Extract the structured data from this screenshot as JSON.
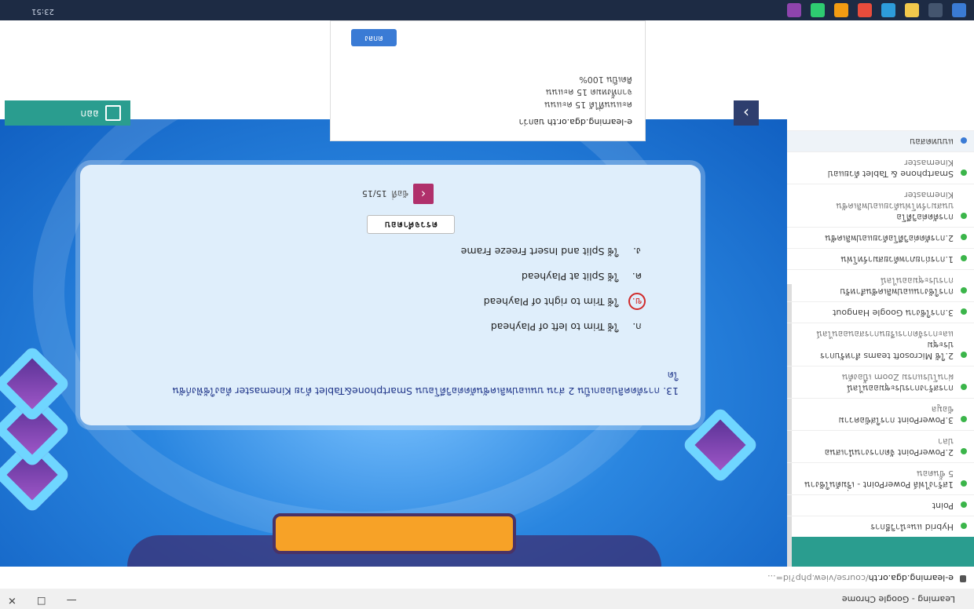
{
  "browser": {
    "window_title": "Learning - Google Chrome",
    "url_host": "e-learning.dga.or.th",
    "url_path": "/course/view.php?id=..."
  },
  "sidebar": {
    "items": [
      {
        "label": "Hybrid แนะนำวิธีการ",
        "sub": "",
        "active": false
      },
      {
        "label": "Point",
        "sub": "",
        "active": false
      },
      {
        "label": "1สร้างไฟล์ PowerPoint - เริ่มต้นใช้งาน",
        "sub": "5 ขั้นตอน",
        "active": false
      },
      {
        "label": "2.PowerPoint จัดการงานนำเสนอ",
        "sub": "ปลา",
        "active": false
      },
      {
        "label": "3.PowerPoint การใส่ข้อความ",
        "sub": "ข้อมูล",
        "active": false
      },
      {
        "label": "การสร้างการประชุมออนไลน์",
        "sub": "ผ่านโปรแกรม Zoom เบื้องต้น",
        "active": false
      },
      {
        "label": "2.ใช้ Microsoft teams สำหรับการประชุม",
        "sub": "และการจัดการเรียนการสอนออนไลน์",
        "active": false
      },
      {
        "label": "3.การใช้งาน Google Hangout",
        "sub": "",
        "active": false
      },
      {
        "label": "การใช้งานแอปพลิเคชันสำหรับ",
        "sub": "การประชุมออนไลน์",
        "active": false
      },
      {
        "label": "1.การถ่ายภาพด้วยสมาร์ทโฟน",
        "sub": "",
        "active": false
      },
      {
        "label": "2.การตัดต่อวิดีโอด้วยแอปพลิเคชัน",
        "sub": "",
        "active": false
      },
      {
        "label": "การตัดต่อวิดีโอ",
        "sub": "บนสมาร์ทโฟนด้วยแอปพลิเคชัน Kinemaster",
        "active": false
      },
      {
        "label": "Smartphone & Tablet ด้วยแอป",
        "sub": "Kinemaster",
        "active": false
      },
      {
        "label": "แบบทดสอบ",
        "sub": "",
        "active": true
      }
    ]
  },
  "quiz": {
    "question": "13. การตัดคลิปออกเป็น 2 ส่วน บนแอปพลิเคชันตัดต่อวิดีโอบน Smartphone&Tablet ด้วย Kinemaster ต้องใช้ฟังก์ชัน",
    "question_tail": "ใด",
    "choices": [
      {
        "label": "ก.",
        "text": "ใช้ Trim to left of Playhead",
        "selected": false
      },
      {
        "label": "ข.",
        "text": "ใช้ Trim to right of Playhead",
        "selected": true
      },
      {
        "label": "ค.",
        "text": "ใช้ Split at Playhead",
        "selected": false
      },
      {
        "label": "ง.",
        "text": "ใช้ Split and Insert Freeze Frame",
        "selected": false
      }
    ],
    "check_label": "ตรวจคำตอบ",
    "counter_label": "ข้อที่",
    "counter": "15/15"
  },
  "info_box": {
    "site": "e-learning.dga.or.th บอกว่า",
    "line1": "คะแนนที่ได้ 15 คะแนน",
    "line2": "จากทั้งหมด 15 คะแนน",
    "line3": "คิดเป็น 100%",
    "ok": "ตกลง"
  },
  "bottom_nav": {
    "exit": "ออก",
    "next_icon": "chevron-right-icon"
  },
  "taskbar": {
    "clock": "23:51"
  }
}
